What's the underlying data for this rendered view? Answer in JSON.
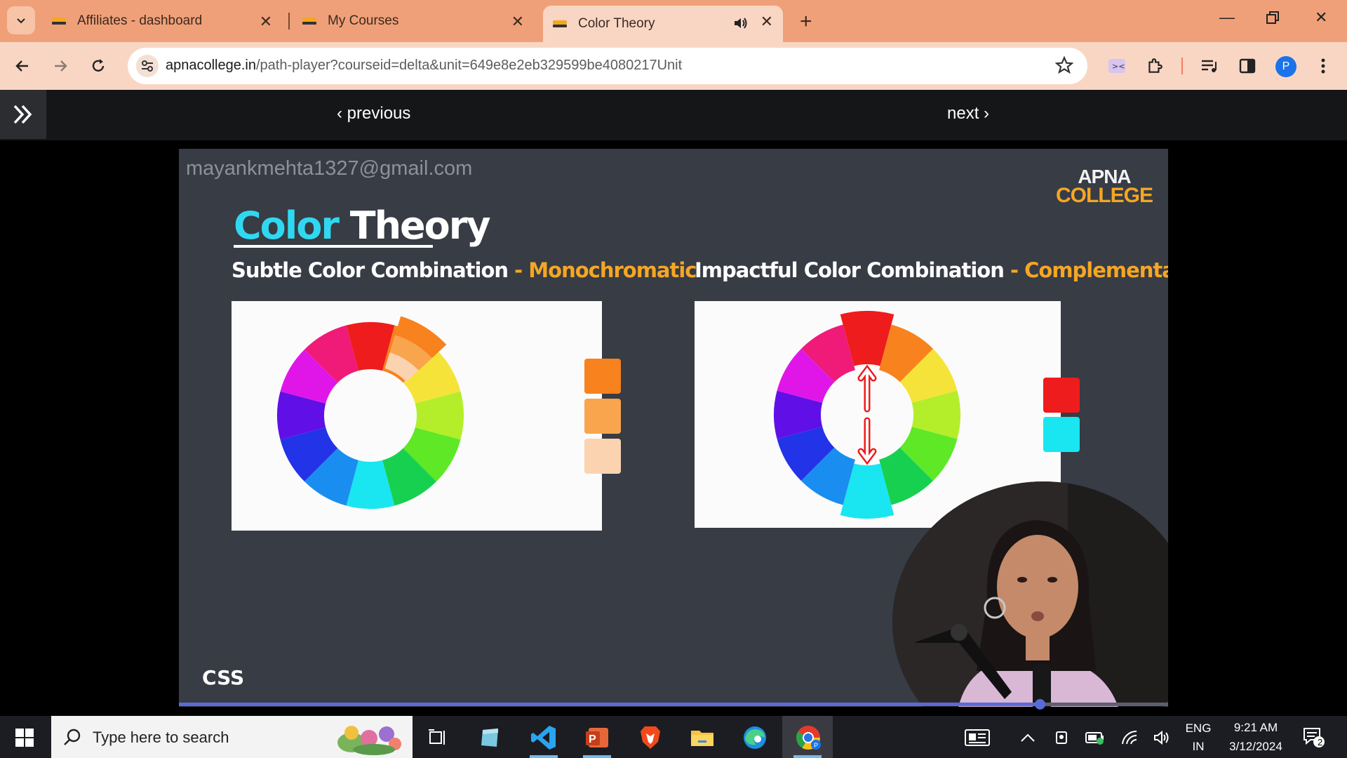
{
  "browser": {
    "tabs": [
      {
        "title": "Affiliates - dashboard",
        "favicon": "apna-college-favicon",
        "active": false
      },
      {
        "title": "My Courses",
        "favicon": "apna-college-favicon",
        "active": false
      },
      {
        "title": "Color Theory",
        "favicon": "apna-college-favicon",
        "active": true,
        "audio": true
      }
    ],
    "address": {
      "host": "apnacollege.in",
      "path": "/path-player?courseid=delta&unit=649e8e2eb329599be4080217Unit"
    },
    "profile_initial": "P"
  },
  "course_nav": {
    "previous_label": "previous",
    "next_label": "next"
  },
  "video": {
    "watermark": "mayankmehta1327@gmail.com",
    "logo_line1": "APNA",
    "logo_line2": "COLLEGE",
    "slide_title_part1": "Color",
    "slide_title_part2": "Theory",
    "left_heading": "Subtle Color Combination",
    "left_heading_sep": " - ",
    "left_heading_accent": "Monochromatic",
    "right_heading": "Impactful Color Combination",
    "right_heading_sep": " - ",
    "right_heading_accent": "Complementary",
    "left_swatches": [
      "#f7821e",
      "#f9a54e",
      "#fbd3b0"
    ],
    "right_swatches": [
      "#ee1c1c",
      "#19e6f0"
    ],
    "course_label": "CSS",
    "progress_fraction": 0.87,
    "accent_color": "#f5a623"
  },
  "taskbar": {
    "search_placeholder": "Type here to search",
    "language_line1": "ENG",
    "language_line2": "IN",
    "time": "9:21 AM",
    "date": "3/12/2024",
    "notification_count": "2"
  }
}
